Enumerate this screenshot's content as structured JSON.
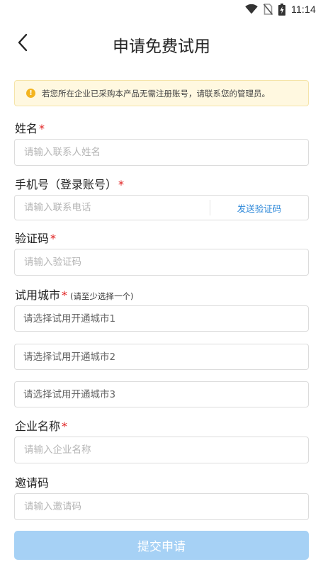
{
  "status_bar": {
    "time": "11:14"
  },
  "header": {
    "title": "申请免费试用"
  },
  "notice": {
    "icon": "warning-icon",
    "text": "若您所在企业已采购本产品无需注册账号，请联系您的管理员。"
  },
  "form": {
    "name": {
      "label": "姓名",
      "required_mark": "*",
      "placeholder": "请输入联系人姓名"
    },
    "phone": {
      "label": "手机号（登录账号）",
      "required_mark": "*",
      "placeholder": "请输入联系电话",
      "send_code": "发送验证码"
    },
    "code": {
      "label": "验证码",
      "required_mark": "*",
      "placeholder": "请输入验证码"
    },
    "city": {
      "label": "试用城市",
      "required_mark": "*",
      "hint": "(请至少选择一个)",
      "city1": "请选择试用开通城市1",
      "city2": "请选择试用开通城市2",
      "city3": "请选择试用开通城市3"
    },
    "company": {
      "label": "企业名称",
      "required_mark": "*",
      "placeholder": "请输入企业名称"
    },
    "invite": {
      "label": "邀请码",
      "placeholder": "请输入邀请码"
    }
  },
  "submit": {
    "label": "提交申请"
  },
  "colors": {
    "accent": "#2a86d8",
    "required": "#e02020",
    "submit_disabled": "#a6d1f5",
    "notice_bg": "#fff8e0"
  }
}
